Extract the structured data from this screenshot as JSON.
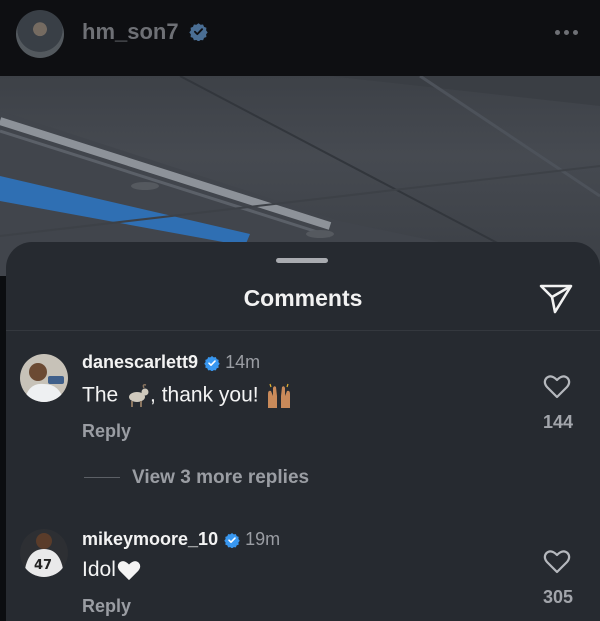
{
  "post": {
    "username": "hm_son7",
    "verified_icon": "verified-badge-icon",
    "more_icon": "more-horizontal-icon"
  },
  "sheet": {
    "title": "Comments",
    "share_icon": "paper-plane-icon"
  },
  "comments": [
    {
      "username": "danescarlett9",
      "verified": true,
      "time": "14m",
      "text_before": "The ",
      "emoji_1": "goat-emoji",
      "text_after": ", thank you!",
      "emoji_2": "raising-hands-emoji",
      "reply_label": "Reply",
      "likes": "144"
    },
    {
      "username": "mikeymoore_10",
      "verified": true,
      "time": "19m",
      "text_before": "Idol",
      "emoji_1": "white-heart-emoji",
      "reply_label": "Reply",
      "likes": "305"
    }
  ],
  "view_replies": "View 3 more replies",
  "colors": {
    "sheet_bg": "#262a30",
    "verified_blue": "#3897f0",
    "muted_text": "#9a9da3"
  }
}
